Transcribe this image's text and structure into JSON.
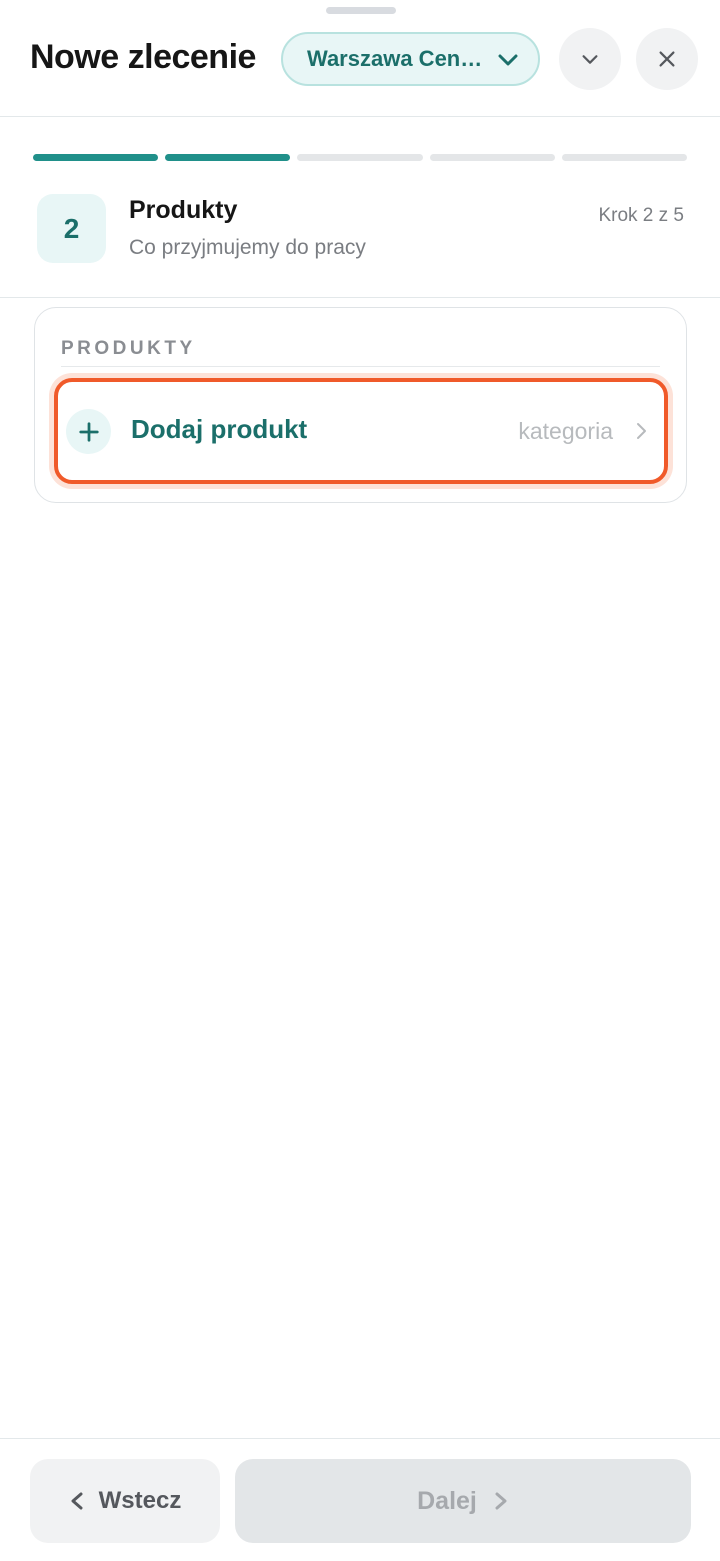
{
  "header": {
    "title": "Nowe zlecenie",
    "location": "Warszawa Centrum",
    "icons": [
      "chevron-down-icon",
      "close-icon"
    ]
  },
  "progress": {
    "total_steps": 5,
    "completed_steps": 2
  },
  "step": {
    "number": "2",
    "title": "Produkty",
    "subtitle": "Co przyjmujemy do pracy",
    "counter": "Krok 2 z 5"
  },
  "products_card": {
    "section_label": "PRODUKTY",
    "add_label": "Dodaj produkt",
    "add_hint": "kategoria"
  },
  "footer": {
    "back_label": "Wstecz",
    "next_label": "Dalej"
  },
  "colors": {
    "accent": "#1b6f6a",
    "progress_done": "#20908a",
    "highlight": "#f05a2a"
  }
}
